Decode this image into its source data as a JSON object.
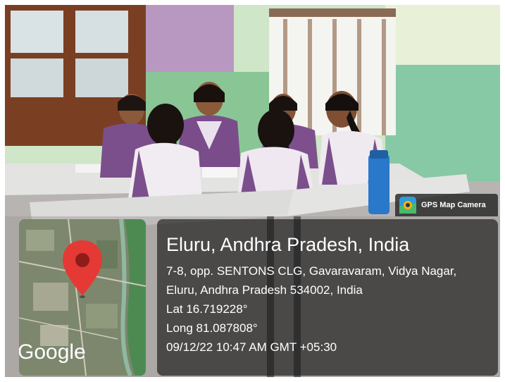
{
  "badge": {
    "label": "GPS Map Camera",
    "icon": "gps-map-camera-icon"
  },
  "map": {
    "brand": "Google",
    "pin_color": "#e53935",
    "pin_icon": "map-pin-icon"
  },
  "location": {
    "title": "Eluru, Andhra Pradesh, India",
    "address": "7-8, opp. SENTONS CLG, Gavaravaram, Vidya Nagar, Eluru, Andhra Pradesh 534002, India",
    "latitude": "Lat 16.719228°",
    "longitude": "Long 81.087808°",
    "timestamp": "09/12/22 10:47 AM GMT +05:30"
  }
}
